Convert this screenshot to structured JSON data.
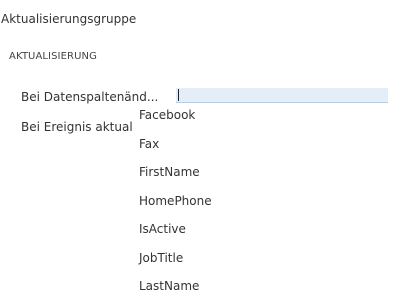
{
  "panel": {
    "title": "Aktualisierungsgruppe",
    "section_header": "AKTUALISIERUNG",
    "rows": [
      {
        "label": "Bei Datenspaltenänd..."
      },
      {
        "label": "Bei Ereignis aktual"
      }
    ],
    "input": {
      "value": ""
    },
    "dropdown": {
      "items": [
        "Facebook",
        "Fax",
        "FirstName",
        "HomePhone",
        "IsActive",
        "JobTitle",
        "LastName"
      ]
    }
  },
  "colors": {
    "input_background": "#e3eef9",
    "text": "#333333"
  }
}
